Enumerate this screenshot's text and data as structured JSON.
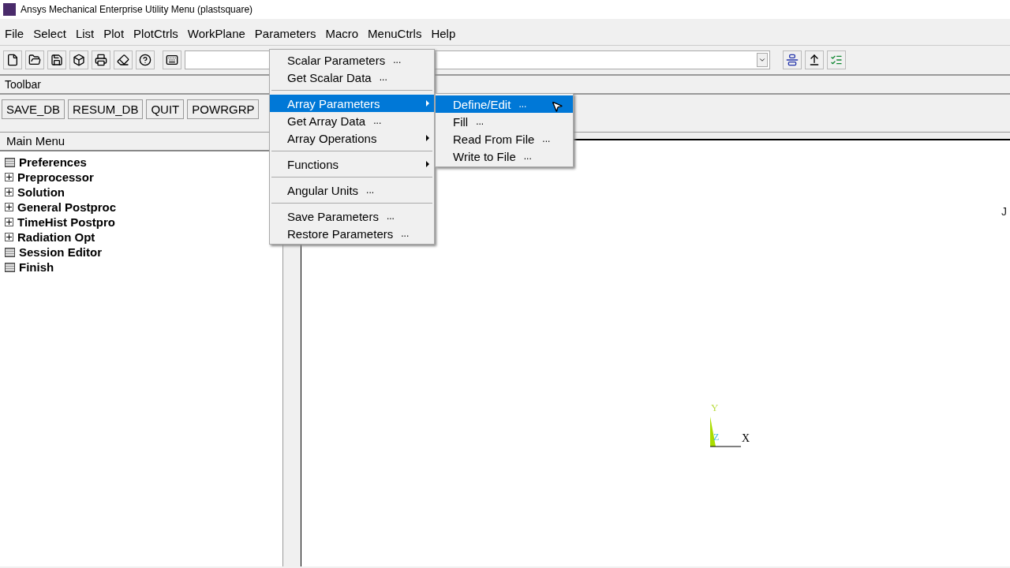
{
  "window": {
    "title": "Ansys Mechanical Enterprise Utility Menu (plastsquare)"
  },
  "menubar": [
    "File",
    "Select",
    "List",
    "Plot",
    "PlotCtrls",
    "WorkPlane",
    "Parameters",
    "Macro",
    "MenuCtrls",
    "Help"
  ],
  "toolbar_title": "Toolbar",
  "toolbar_buttons": [
    "SAVE_DB",
    "RESUM_DB",
    "QUIT",
    "POWRGRP"
  ],
  "main_menu": {
    "title": "Main Menu",
    "items": [
      {
        "label": "Preferences",
        "kind": "command"
      },
      {
        "label": "Preprocessor",
        "kind": "expandable"
      },
      {
        "label": "Solution",
        "kind": "expandable"
      },
      {
        "label": "General Postproc",
        "kind": "expandable"
      },
      {
        "label": "TimeHist Postpro",
        "kind": "expandable"
      },
      {
        "label": "Radiation Opt",
        "kind": "expandable"
      },
      {
        "label": "Session Editor",
        "kind": "command"
      },
      {
        "label": "Finish",
        "kind": "command"
      }
    ]
  },
  "parameters_menu": [
    {
      "kind": "item",
      "label": "Scalar Parameters",
      "hint": "...",
      "selected": false,
      "submenu": false
    },
    {
      "kind": "item",
      "label": "Get Scalar Data",
      "hint": "...",
      "selected": false,
      "submenu": false
    },
    {
      "kind": "separator"
    },
    {
      "kind": "item",
      "label": "Array Parameters",
      "selected": true,
      "submenu": true
    },
    {
      "kind": "item",
      "label": "Get Array Data",
      "hint": "...",
      "selected": false,
      "submenu": false
    },
    {
      "kind": "item",
      "label": "Array Operations",
      "selected": false,
      "submenu": true
    },
    {
      "kind": "separator"
    },
    {
      "kind": "item",
      "label": "Functions",
      "selected": false,
      "submenu": true
    },
    {
      "kind": "separator"
    },
    {
      "kind": "item",
      "label": "Angular Units",
      "hint": "...",
      "selected": false,
      "submenu": false
    },
    {
      "kind": "separator"
    },
    {
      "kind": "item",
      "label": "Save Parameters",
      "hint": "...",
      "selected": false,
      "submenu": false
    },
    {
      "kind": "item",
      "label": "Restore Parameters",
      "hint": "...",
      "selected": false,
      "submenu": false
    }
  ],
  "array_submenu": [
    {
      "label": "Define/Edit",
      "hint": "...",
      "selected": true
    },
    {
      "label": "Fill",
      "hint": "...",
      "selected": false
    },
    {
      "label": "Read From File",
      "hint": "...",
      "selected": false
    },
    {
      "label": "Write to File",
      "hint": "...",
      "selected": false
    }
  ],
  "graphics": {
    "corner_text": "J",
    "triad": {
      "x": "X",
      "y": "Y",
      "z": "Z"
    }
  }
}
